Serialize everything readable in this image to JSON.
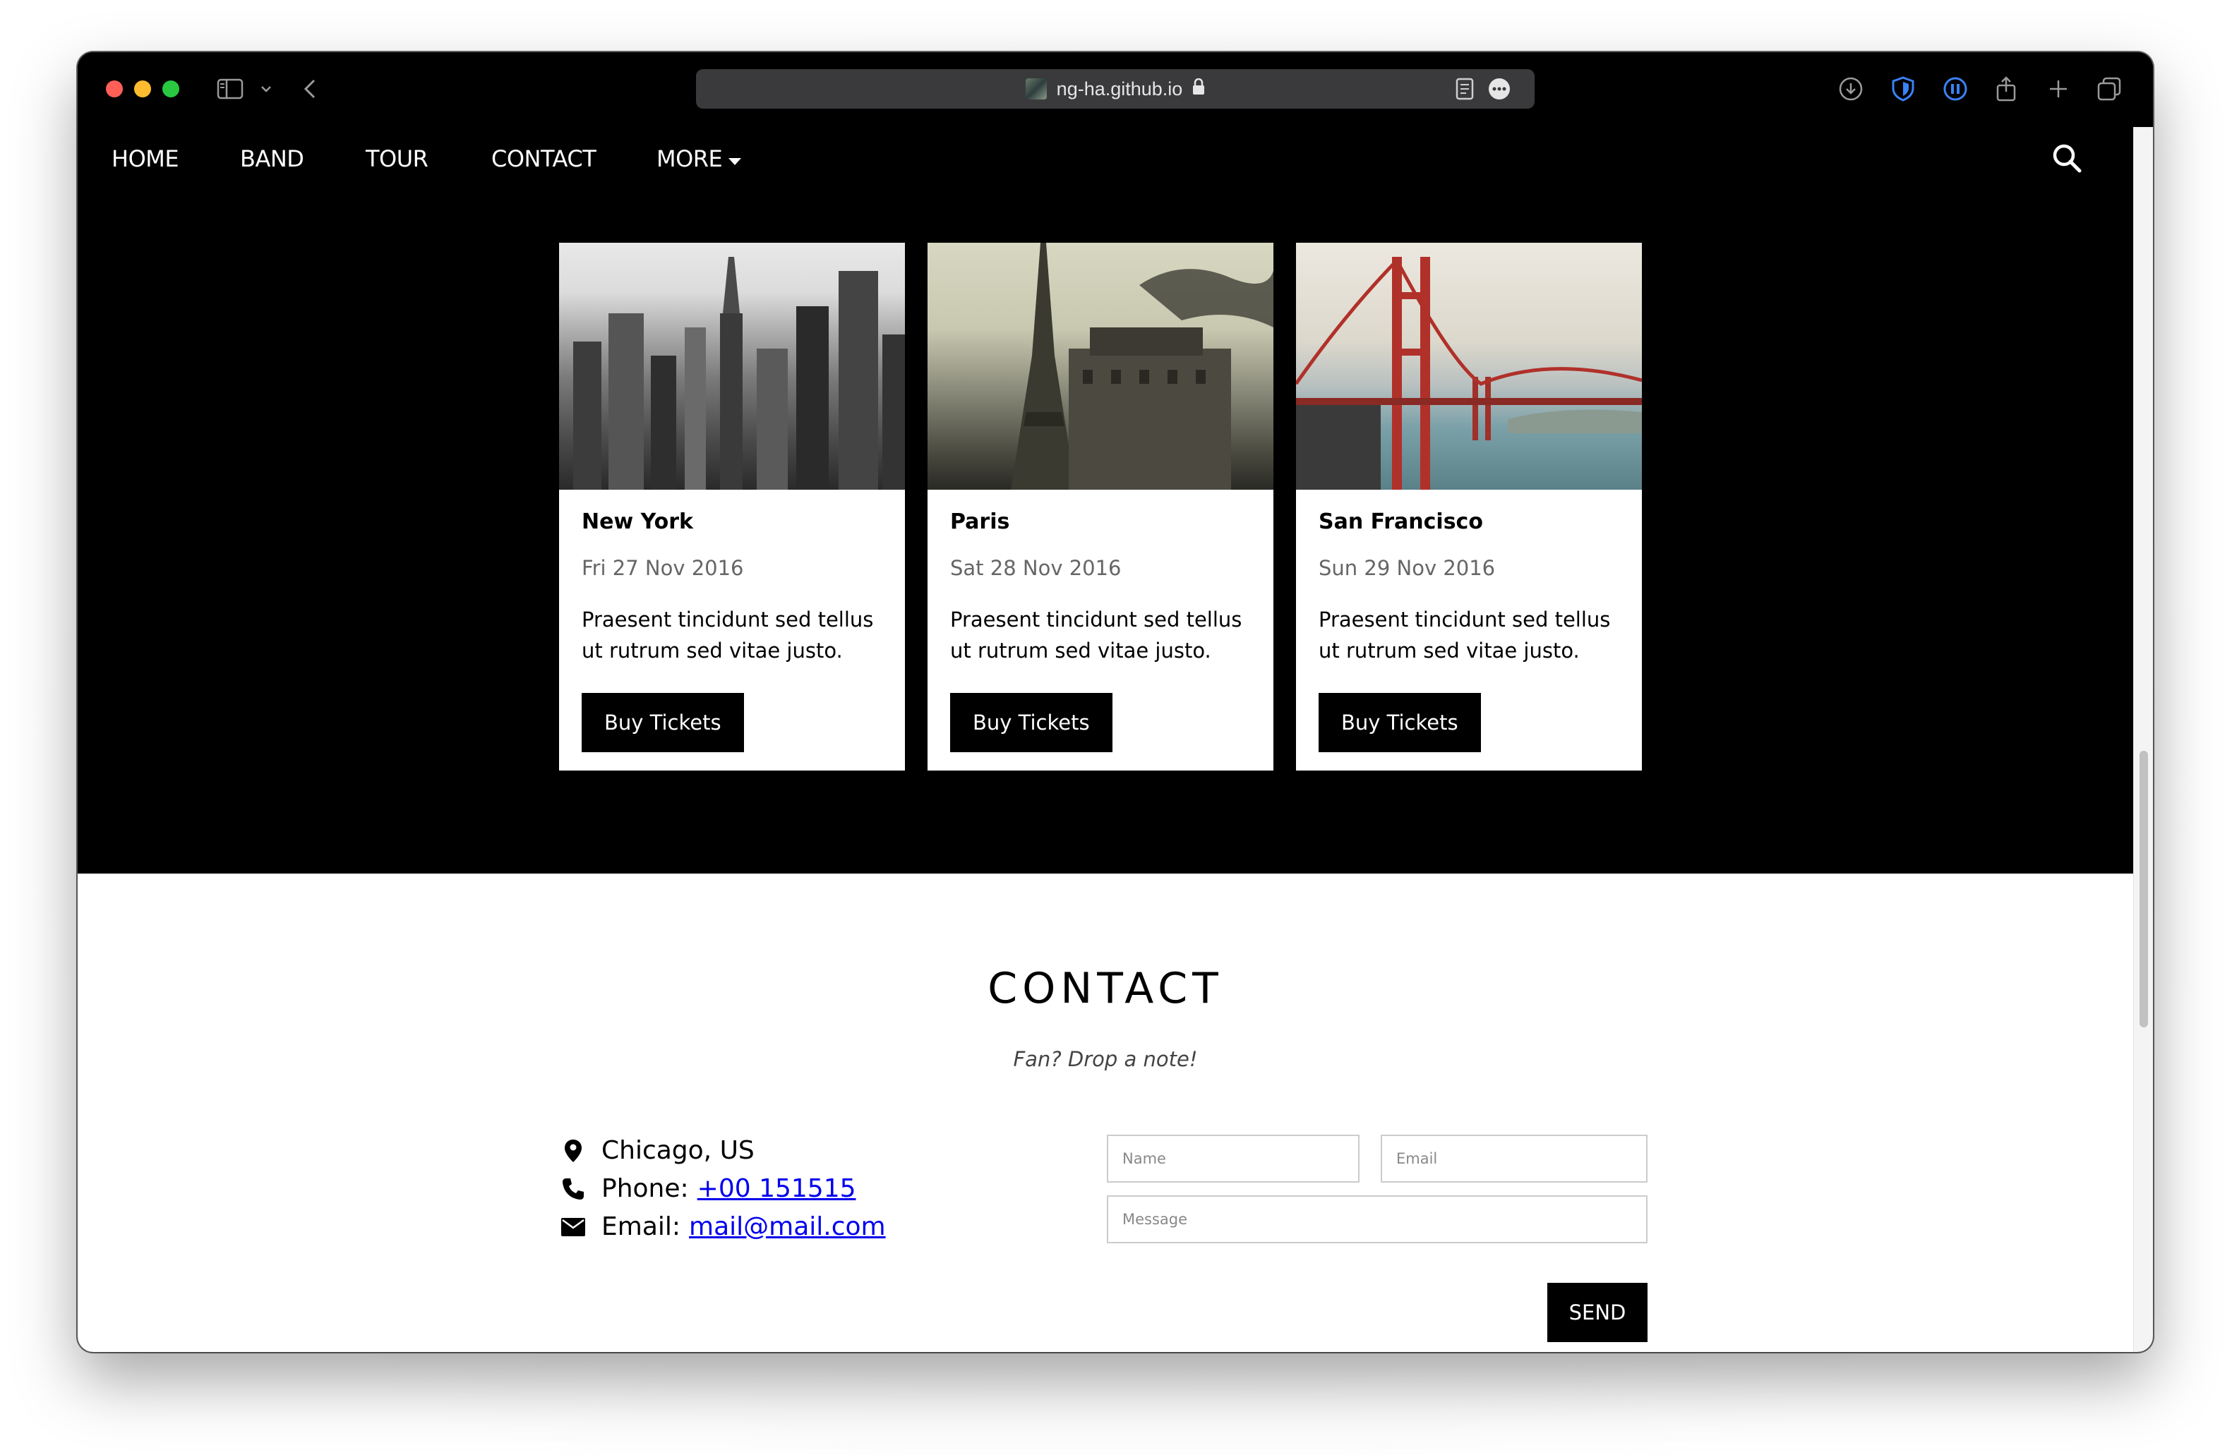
{
  "browser": {
    "url": "ng-ha.github.io"
  },
  "nav": {
    "items": [
      {
        "label": "HOME"
      },
      {
        "label": "BAND"
      },
      {
        "label": "TOUR"
      },
      {
        "label": "CONTACT"
      },
      {
        "label": "MORE"
      }
    ]
  },
  "tour": {
    "cards": [
      {
        "city": "New York",
        "date": "Fri 27 Nov 2016",
        "description": "Praesent tincidunt sed tellus ut rutrum sed vitae justo.",
        "button": "Buy Tickets"
      },
      {
        "city": "Paris",
        "date": "Sat 28 Nov 2016",
        "description": "Praesent tincidunt sed tellus ut rutrum sed vitae justo.",
        "button": "Buy Tickets"
      },
      {
        "city": "San Francisco",
        "date": "Sun 29 Nov 2016",
        "description": "Praesent tincidunt sed tellus ut rutrum sed vitae justo.",
        "button": "Buy Tickets"
      }
    ]
  },
  "contact": {
    "title": "CONTACT",
    "subtitle": "Fan? Drop a note!",
    "location": "Chicago, US",
    "phone_label": "Phone:",
    "phone": "+00 151515",
    "email_label": "Email:",
    "email": "mail@mail.com",
    "form": {
      "name_placeholder": "Name",
      "email_placeholder": "Email",
      "message_placeholder": "Message",
      "send_label": "SEND"
    }
  },
  "colors": {
    "page_dark": "#000000",
    "link": "#0000ee",
    "button": "#000000"
  }
}
